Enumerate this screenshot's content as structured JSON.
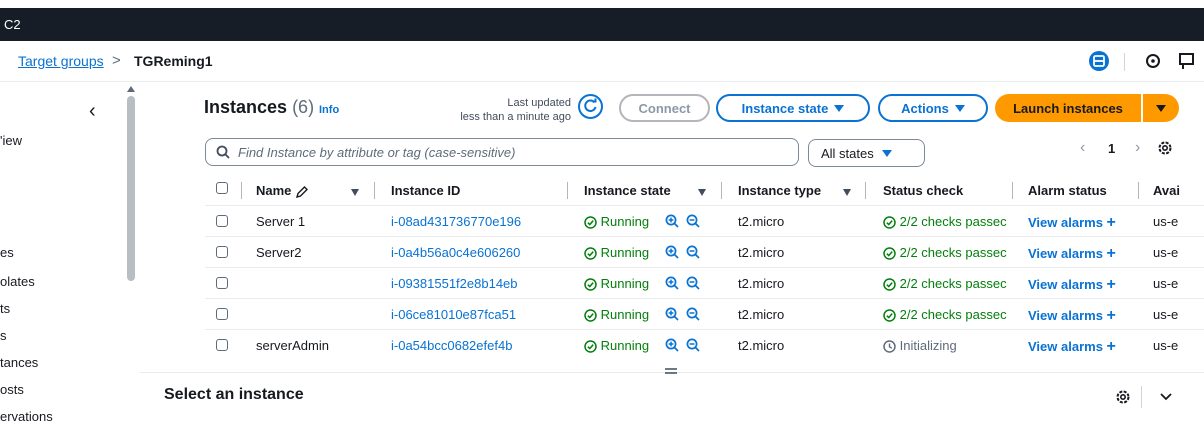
{
  "app": {
    "service": "C2"
  },
  "breadcrumb": {
    "parent": "Target groups",
    "separator": ">",
    "current": "TGReming1"
  },
  "sidebar": {
    "items": [
      "'iew",
      "es",
      "olates",
      "ts",
      "s",
      "tances",
      "osts",
      "ervations"
    ]
  },
  "panel": {
    "title": "Instances",
    "count": "(6)",
    "info": "Info",
    "last_updated_label": "Last updated",
    "last_updated_value": "less than a minute ago"
  },
  "buttons": {
    "connect": "Connect",
    "instance_state": "Instance state",
    "actions": "Actions",
    "launch": "Launch instances"
  },
  "search": {
    "placeholder": "Find Instance by attribute or tag (case-sensitive)"
  },
  "filter": {
    "states": "All states"
  },
  "pagination": {
    "page": "1"
  },
  "columns": {
    "name": "Name",
    "instance_id": "Instance ID",
    "instance_state": "Instance state",
    "instance_type": "Instance type",
    "status_check": "Status check",
    "alarm_status": "Alarm status",
    "az": "Avai"
  },
  "rows": [
    {
      "name": "Server 1",
      "id": "i-08ad431736770e196",
      "state": "Running",
      "type": "t2.micro",
      "status": "2/2 checks passec",
      "alarm": "View alarms",
      "az": "us-e"
    },
    {
      "name": "Server2",
      "id": "i-0a4b56a0c4e606260",
      "state": "Running",
      "type": "t2.micro",
      "status": "2/2 checks passec",
      "alarm": "View alarms",
      "az": "us-e"
    },
    {
      "name": "",
      "id": "i-09381551f2e8b14eb",
      "state": "Running",
      "type": "t2.micro",
      "status": "2/2 checks passec",
      "alarm": "View alarms",
      "az": "us-e"
    },
    {
      "name": "",
      "id": "i-06ce81010e87fca51",
      "state": "Running",
      "type": "t2.micro",
      "status": "2/2 checks passec",
      "alarm": "View alarms",
      "az": "us-e"
    },
    {
      "name": "serverAdmin",
      "id": "i-0a54bcc0682efef4b",
      "state": "Running",
      "type": "t2.micro",
      "status": "Initializing",
      "alarm": "View alarms",
      "az": "us-e"
    }
  ],
  "details": {
    "title": "Select an instance"
  },
  "colors": {
    "accent": "#0972d3",
    "primary": "#ff9900",
    "topbar": "#161d26",
    "success": "#037f0c"
  }
}
